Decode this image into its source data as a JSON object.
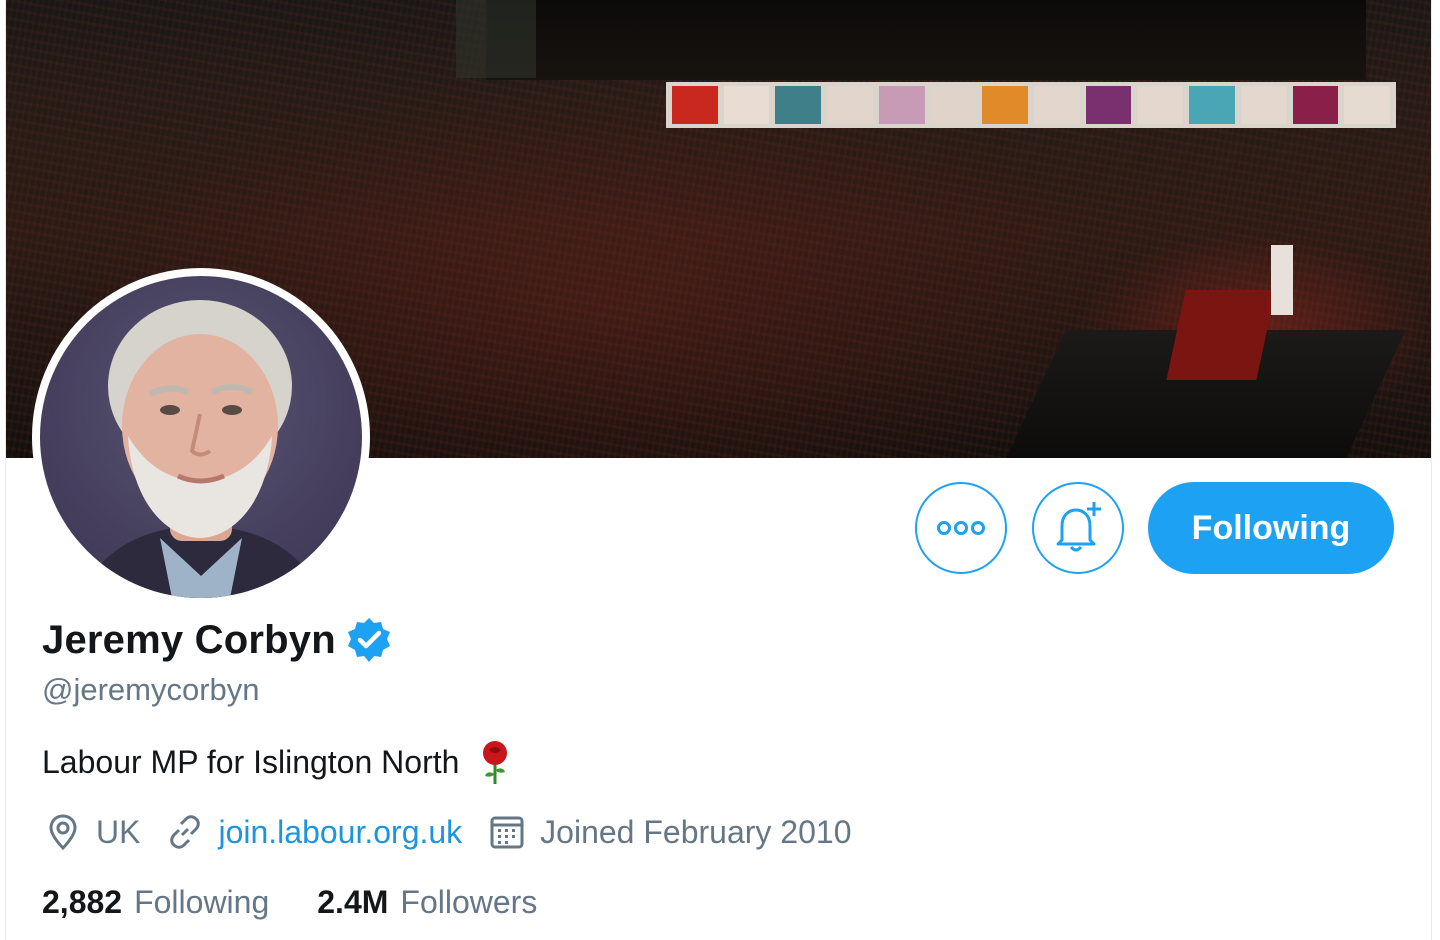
{
  "profile": {
    "display_name": "Jeremy Corbyn",
    "handle": "@jeremycorbyn",
    "bio": "Labour MP for Islington North",
    "verified": true
  },
  "actions": {
    "more_icon": "more-dots-icon",
    "notify_icon": "bell-plus-icon",
    "follow_label": "Following"
  },
  "meta": {
    "location": "UK",
    "website": "join.labour.org.uk",
    "joined": "Joined February 2010"
  },
  "stats": {
    "following_count": "2,882",
    "following_label": "Following",
    "followers_count": "2.4M",
    "followers_label": "Followers"
  },
  "colors": {
    "accent": "#1da1f2",
    "link": "#1b95e0",
    "muted": "#657786",
    "text": "#14171a"
  }
}
